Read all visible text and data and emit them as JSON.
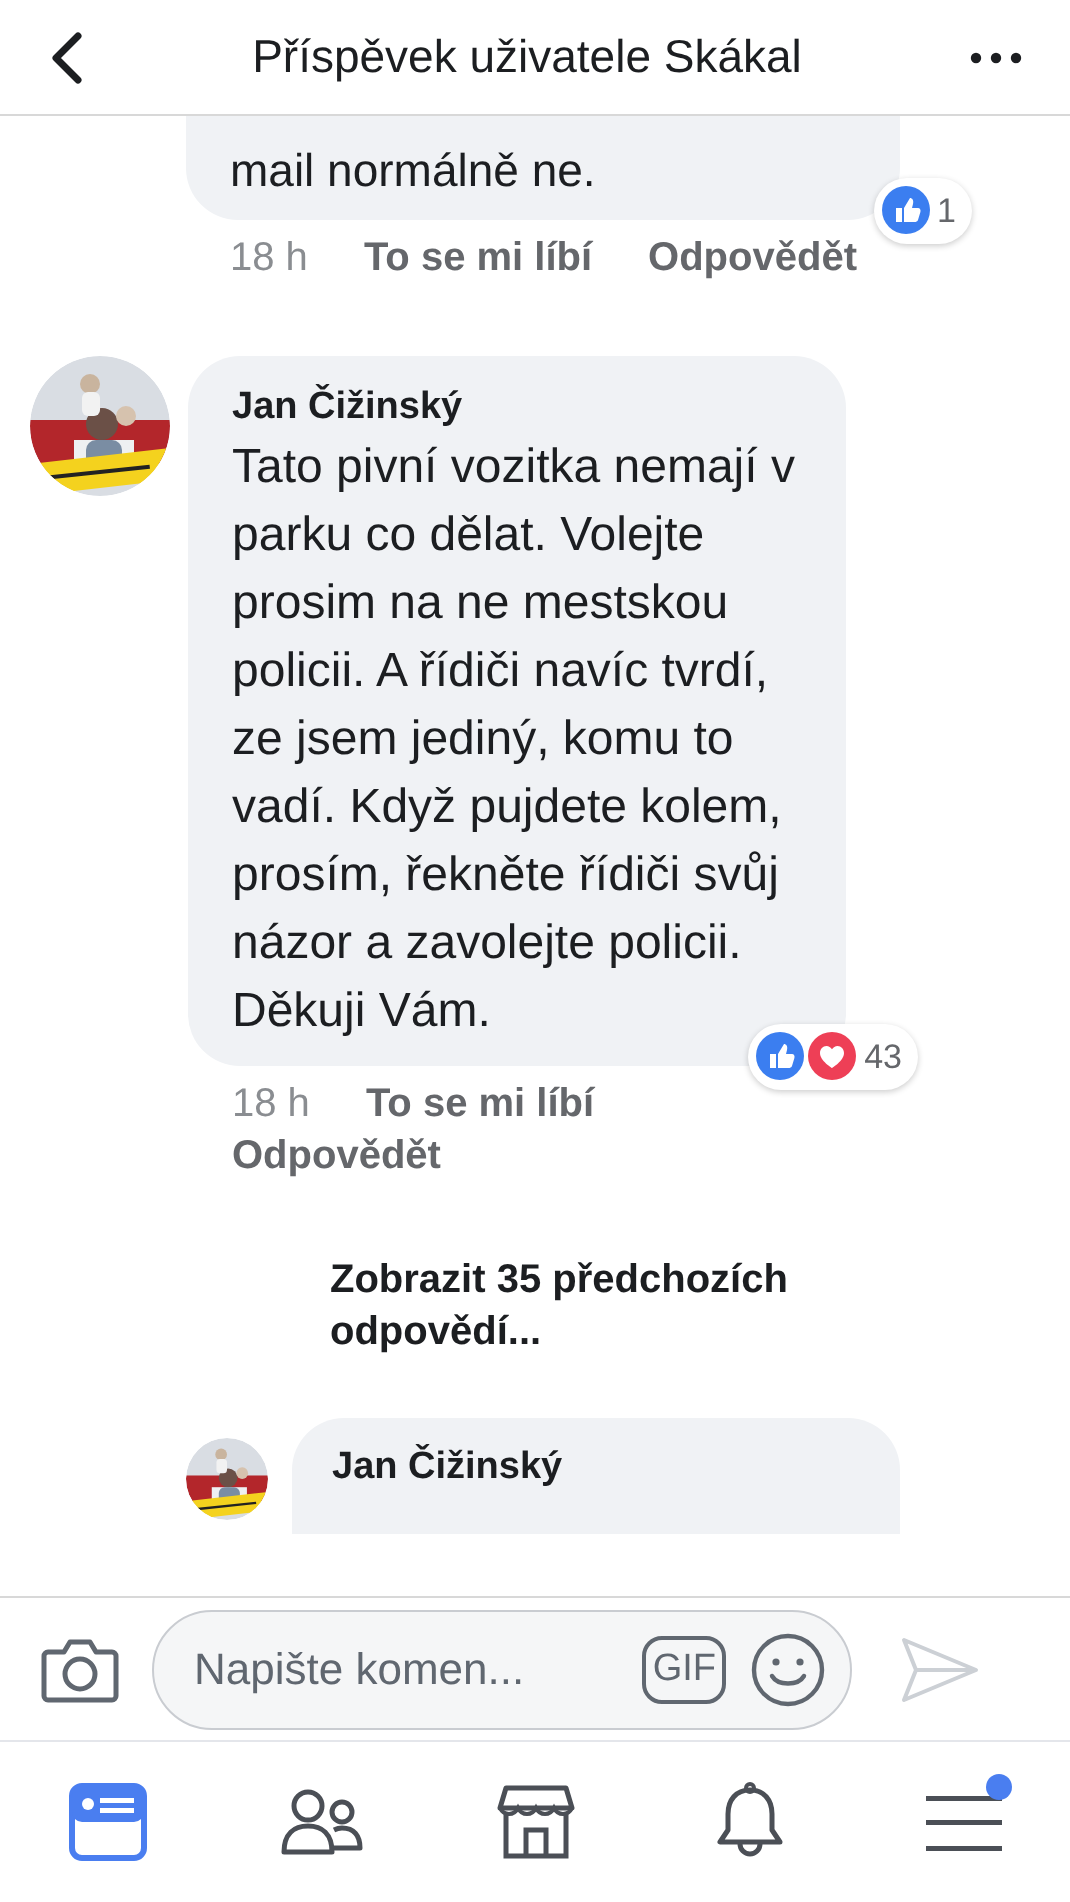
{
  "header": {
    "title": "Příspěvek uživatele Skákal"
  },
  "comments": [
    {
      "kind": "cut_top",
      "text": "mail normálně ne.",
      "reactions": [
        {
          "kind": "like"
        }
      ],
      "reaction_count": "1",
      "time": "18 h",
      "like": "To se mi líbí",
      "reply": "Odpovědět"
    },
    {
      "kind": "full",
      "author": "Jan Čižinský",
      "text": "Tato pivní vozitka nemají v parku co dělat. Volejte prosim na ne mestskou policii. A řídiči navíc tvrdí, ze jsem jediný, komu to vadí. Když pujdete kolem, prosím, řekněte řídiči svůj názor a zavolejte policii. Děkuji Vám.",
      "reactions": [
        {
          "kind": "like"
        },
        {
          "kind": "love"
        }
      ],
      "reaction_count": "43",
      "time": "18 h",
      "like": "To se mi líbí",
      "reply": "Odpovědět"
    }
  ],
  "more_replies": "Zobrazit 35 předchozích odpovědí...",
  "replies": [
    {
      "kind": "cut_bottom",
      "author": "Jan Čižinský"
    }
  ],
  "composer": {
    "placeholder": "Napište komen...",
    "gif": "GIF"
  },
  "tabs": [
    {
      "kind": "feed",
      "selected": true,
      "notification_dot": false
    },
    {
      "kind": "friends",
      "selected": false,
      "notification_dot": false
    },
    {
      "kind": "marketplace",
      "selected": false,
      "notification_dot": false
    },
    {
      "kind": "notifications",
      "selected": false,
      "notification_dot": false
    },
    {
      "kind": "menu",
      "selected": false,
      "notification_dot": true
    }
  ]
}
